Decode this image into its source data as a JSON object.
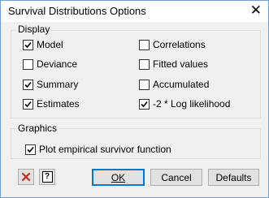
{
  "window": {
    "title": "Survival Distributions Options"
  },
  "display": {
    "label": "Display",
    "left_options": [
      {
        "label": "Model",
        "checked": true
      },
      {
        "label": "Deviance",
        "checked": false
      },
      {
        "label": "Summary",
        "checked": true
      },
      {
        "label": "Estimates",
        "checked": true
      }
    ],
    "right_options": [
      {
        "label": "Correlations",
        "checked": false
      },
      {
        "label": "Fitted values",
        "checked": false
      },
      {
        "label": "Accumulated",
        "checked": false
      },
      {
        "label": "-2 * Log likelihood",
        "checked": true
      }
    ]
  },
  "graphics": {
    "label": "Graphics",
    "options": [
      {
        "label": "Plot empirical survivor function",
        "checked": true
      }
    ]
  },
  "buttons": {
    "ok": "OK",
    "cancel": "Cancel",
    "defaults": "Defaults",
    "help": "?"
  },
  "colors": {
    "close_red": "#c42b1c",
    "focus_blue": "#0078d7",
    "frame": "#6d9fd2"
  },
  "icons": {
    "close": "close-icon",
    "clear": "red-x-icon",
    "help": "help-icon"
  }
}
